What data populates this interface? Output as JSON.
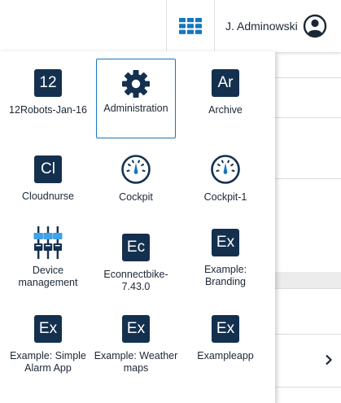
{
  "header": {
    "user_name": "J. Adminowski",
    "apps_icon": "grid-icon",
    "user_icon": "user-circle-icon"
  },
  "colors": {
    "accent": "#1776bf",
    "icon_bg": "#14304f",
    "text": "#1b2735"
  },
  "apps": [
    {
      "label": "12Robots-Jan-16",
      "abbr": "12",
      "icon": "abbr"
    },
    {
      "label": "Administration",
      "abbr": "",
      "icon": "gear-icon",
      "active": true
    },
    {
      "label": "Archive",
      "abbr": "Ar",
      "icon": "abbr"
    },
    {
      "label": "Cloudnurse",
      "abbr": "Cl",
      "icon": "abbr"
    },
    {
      "label": "Cockpit",
      "abbr": "",
      "icon": "gauge-icon"
    },
    {
      "label": "Cockpit-1",
      "abbr": "",
      "icon": "gauge-icon"
    },
    {
      "label": "Device management",
      "abbr": "",
      "icon": "device-sliders-icon"
    },
    {
      "label": "Econnectbike-7.43.0",
      "abbr": "Ec",
      "icon": "abbr"
    },
    {
      "label": "Example: Branding",
      "abbr": "Ex",
      "icon": "abbr"
    },
    {
      "label": "Example: Simple Alarm App",
      "abbr": "Ex",
      "icon": "abbr"
    },
    {
      "label": "Example: Weather maps",
      "abbr": "Ex",
      "icon": "abbr"
    },
    {
      "label": "Exampleapp",
      "abbr": "Ex",
      "icon": "abbr"
    }
  ]
}
